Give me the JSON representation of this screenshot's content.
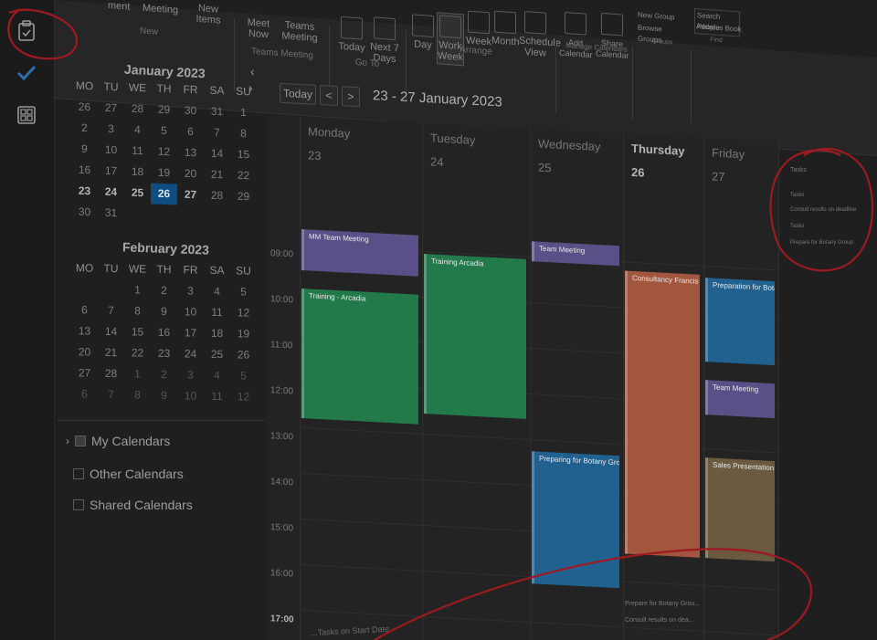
{
  "ribbon": {
    "new_group": "New",
    "new_item_1": "ment",
    "new_item_2": "Meeting",
    "new_items": "New Items",
    "teams_meet_now": "Meet Now",
    "teams_meeting": "Teams Meeting",
    "teams_group": "Teams Meeting",
    "today": "Today",
    "next7": "Next 7 Days",
    "goto_group": "Go To",
    "day": "Day",
    "work_week": "Work Week",
    "week": "Week",
    "month": "Month",
    "schedule_view": "Schedule View",
    "arrange_group": "Arrange",
    "add_calendar": "Add Calendar",
    "share_calendar": "Share Calendar",
    "manage_group": "Manage Calendars",
    "new_group_btn": "New Group",
    "browse_groups": "Browse Groups",
    "groups_group": "Groups",
    "search_people": "Search People",
    "address_book": "Address Book",
    "find_group": "Find"
  },
  "minical": {
    "january": {
      "title": "January 2023",
      "headers": [
        "MO",
        "TU",
        "WE",
        "TH",
        "FR",
        "SA",
        "SU"
      ],
      "rows": [
        [
          "26",
          "27",
          "28",
          "29",
          "30",
          "31",
          "1"
        ],
        [
          "2",
          "3",
          "4",
          "5",
          "6",
          "7",
          "8"
        ],
        [
          "9",
          "10",
          "11",
          "12",
          "13",
          "14",
          "15"
        ],
        [
          "16",
          "17",
          "18",
          "19",
          "20",
          "21",
          "22"
        ],
        [
          "23",
          "24",
          "25",
          "26",
          "27",
          "28",
          "29"
        ],
        [
          "30",
          "31",
          "",
          "",
          "",
          "",
          ""
        ]
      ]
    },
    "february": {
      "title": "February 2023",
      "headers": [
        "MO",
        "TU",
        "WE",
        "TH",
        "FR",
        "SA",
        "SU"
      ],
      "rows": [
        [
          "",
          "",
          "1",
          "2",
          "3",
          "4",
          "5"
        ],
        [
          "6",
          "7",
          "8",
          "9",
          "10",
          "11",
          "12"
        ],
        [
          "13",
          "14",
          "15",
          "16",
          "17",
          "18",
          "19"
        ],
        [
          "20",
          "21",
          "22",
          "23",
          "24",
          "25",
          "26"
        ],
        [
          "27",
          "28",
          "1",
          "2",
          "3",
          "4",
          "5"
        ],
        [
          "6",
          "7",
          "8",
          "9",
          "10",
          "11",
          "12"
        ]
      ]
    }
  },
  "calendars": {
    "my": "My Calendars",
    "other": "Other Calendars",
    "shared": "Shared Calendars"
  },
  "toolbar": {
    "today": "Today",
    "prev": "<",
    "next": ">",
    "range": "23 - 27 January 2023",
    "view_label": "Work Week"
  },
  "days": [
    {
      "name": "Monday",
      "date": "23"
    },
    {
      "name": "Tuesday",
      "date": "24"
    },
    {
      "name": "Wednesday",
      "date": "25"
    },
    {
      "name": "Thursday",
      "date": "26"
    },
    {
      "name": "Friday",
      "date": "27"
    }
  ],
  "hours": [
    "09:00",
    "10:00",
    "11:00",
    "12:00",
    "13:00",
    "14:00",
    "15:00",
    "16:00",
    "17:00"
  ],
  "events": {
    "mm_team": "MM Team Meeting",
    "training_mon": "Training - Arcadia",
    "training_tue": "Training Arcadia",
    "team_wed": "Team Meeting",
    "prep_wed": "Preparing for Botany Group",
    "consult_thu": "Consultancy Francis Group",
    "prep_fri": "Preparation for Botany Group",
    "team_fri": "Team Meeting",
    "sales_fri": "Sales Presentation"
  },
  "colors": {
    "purple": "#5a4f86",
    "green": "#227a4b",
    "orange": "#a2563d",
    "blue": "#20618f",
    "brown": "#6b5a40",
    "annotation": "#b5121b"
  },
  "right_pane": {
    "title": "Tasks",
    "item1": "Tasks",
    "item2": "Consult results on deadline",
    "item3": "Tasks",
    "item4": "Prepare for Botany Group"
  },
  "bottom_tasks": {
    "item1": "Prepare for Botany Grou...",
    "item2": "Consult results on dea..."
  },
  "start_date_hint": "...Tasks on Start Date"
}
